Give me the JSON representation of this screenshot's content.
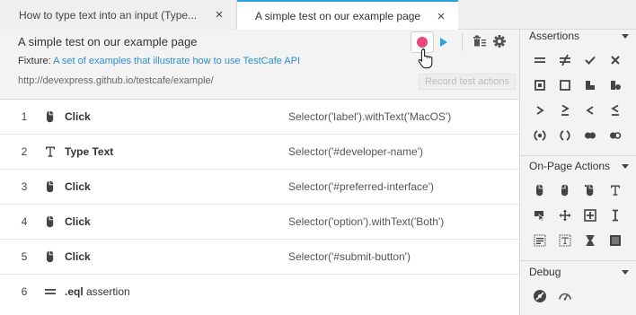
{
  "tabs": [
    {
      "label": "How to type text into an input (Type...",
      "active": false
    },
    {
      "label": "A simple test on our example page",
      "active": true
    }
  ],
  "test": {
    "title": "A simple test on our example page",
    "fixture_label": "Fixture:",
    "fixture_link": "A set of examples that illustrate how to use TestCafe API",
    "url": "http://devexpress.github.io/testcafe/example/",
    "tooltip": "Record test actions"
  },
  "steps": [
    {
      "num": "1",
      "icon": "mouse-click-icon",
      "name": "Click",
      "arg": "Selector('label').withText('MacOS')"
    },
    {
      "num": "2",
      "icon": "type-text-icon",
      "name": "Type Text",
      "arg": "Selector('#developer-name')"
    },
    {
      "num": "3",
      "icon": "mouse-click-icon",
      "name": "Click",
      "arg": "Selector('#preferred-interface')"
    },
    {
      "num": "4",
      "icon": "mouse-click-icon",
      "name": "Click",
      "arg": "Selector('option').withText('Both')"
    },
    {
      "num": "5",
      "icon": "mouse-click-icon",
      "name": "Click",
      "arg": "Selector('#submit-button')"
    },
    {
      "num": "6",
      "icon": "equals-icon",
      "name": ".eql",
      "name_suffix": " assertion",
      "arg": ""
    }
  ],
  "panel": {
    "assertions_title": "Assertions",
    "onpage_title": "On-Page Actions",
    "debug_title": "Debug"
  },
  "colors": {
    "accent": "#2ea3d8",
    "record": "#e8467c",
    "link": "#2b8fcf"
  }
}
